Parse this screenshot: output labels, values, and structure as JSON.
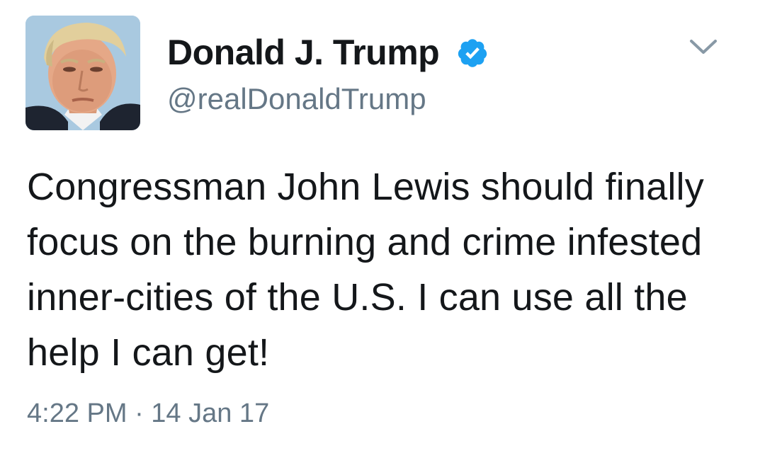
{
  "tweet": {
    "display_name": "Donald J. Trump",
    "handle": "@realDonaldTrump",
    "verified": true,
    "text": "Congressman John Lewis should finally focus on the burning and crime infested inner-cities of the U.S. I can use all the help I can get!",
    "timestamp": "4:22 PM · 14 Jan 17",
    "icons": {
      "verified": "verified-badge-icon",
      "menu": "chevron-down-icon"
    },
    "colors": {
      "name": "#14171a",
      "secondary": "#657786",
      "verified": "#1da1f2"
    }
  }
}
